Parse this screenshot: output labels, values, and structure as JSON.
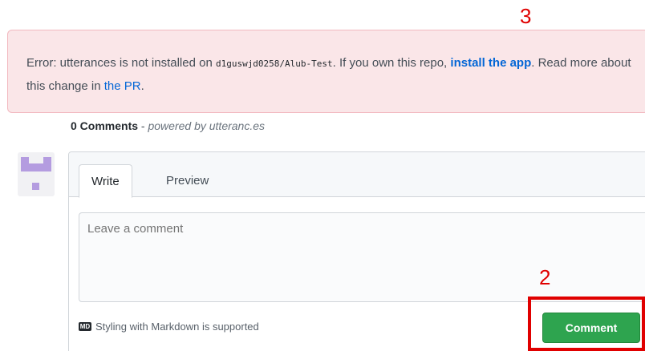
{
  "annotations": {
    "label_install": "3",
    "label_comment": "2"
  },
  "error_banner": {
    "prefix": "Error: utterances is not installed on ",
    "repo": "d1guswjd0258/Alub-Test",
    "middle": ". If you own this repo, ",
    "install_link": "install the app",
    "after_link": ". Read more about this change in ",
    "pr_link": "the PR",
    "end": "."
  },
  "comments": {
    "count_label": "0 Comments",
    "separator": " - ",
    "powered_by": "powered by utteranc.es"
  },
  "editor": {
    "tab_write": "Write",
    "tab_preview": "Preview",
    "placeholder": "Leave a comment",
    "markdown_icon_text": "MD",
    "markdown_note": "Styling with Markdown is supported",
    "submit_label": "Comment"
  },
  "colors": {
    "error_bg": "#fae6e8",
    "link": "#0366d6",
    "submit_green": "#2ea44f",
    "annotation_red": "#e00000",
    "avatar_purple": "#b49ce0"
  }
}
